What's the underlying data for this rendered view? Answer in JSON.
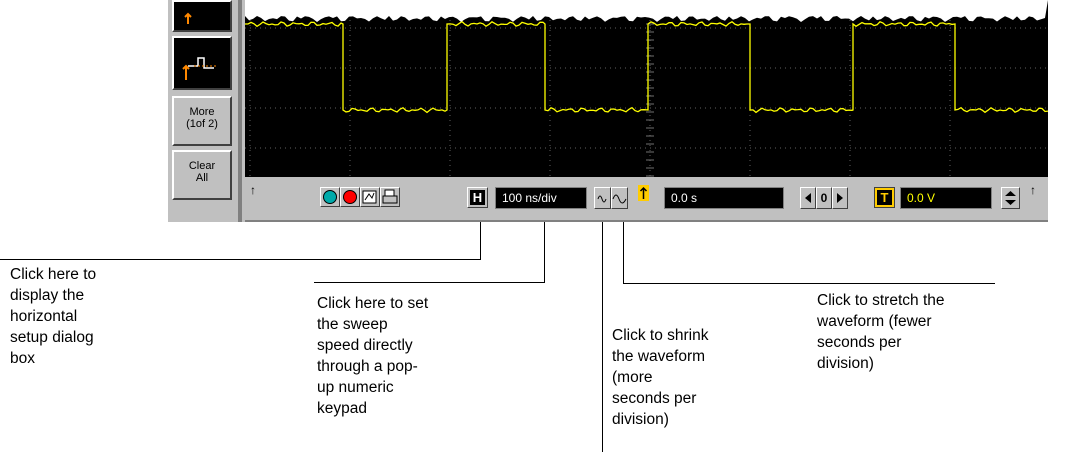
{
  "softkeys": {
    "more_label": "More\n(1of 2)",
    "clear_label": "Clear\nAll"
  },
  "toolbar": {
    "horizontal_button": "H",
    "sweep_speed": "100 ns/div",
    "delay": "0.0 s",
    "delay_zero": "0",
    "trigger_button": "T",
    "trigger_level": "0.0 V"
  },
  "colors": {
    "trace": "#ffff00",
    "run_button": "#00aaaa",
    "stop_button": "#ff0000",
    "trigger_level_text": "#ffff00"
  },
  "callouts": {
    "horizontal_setup": "Click here to\ndisplay the\nhorizontal\nsetup dialog\nbox",
    "sweep_speed": "Click here to set\nthe sweep\nspeed directly\nthrough a pop-\nup numeric\nkeypad",
    "shrink": "Click to shrink\nthe waveform\n(more\nseconds per\ndivision)",
    "stretch": "Click to stretch the\nwaveform (fewer\nseconds per\ndivision)"
  }
}
